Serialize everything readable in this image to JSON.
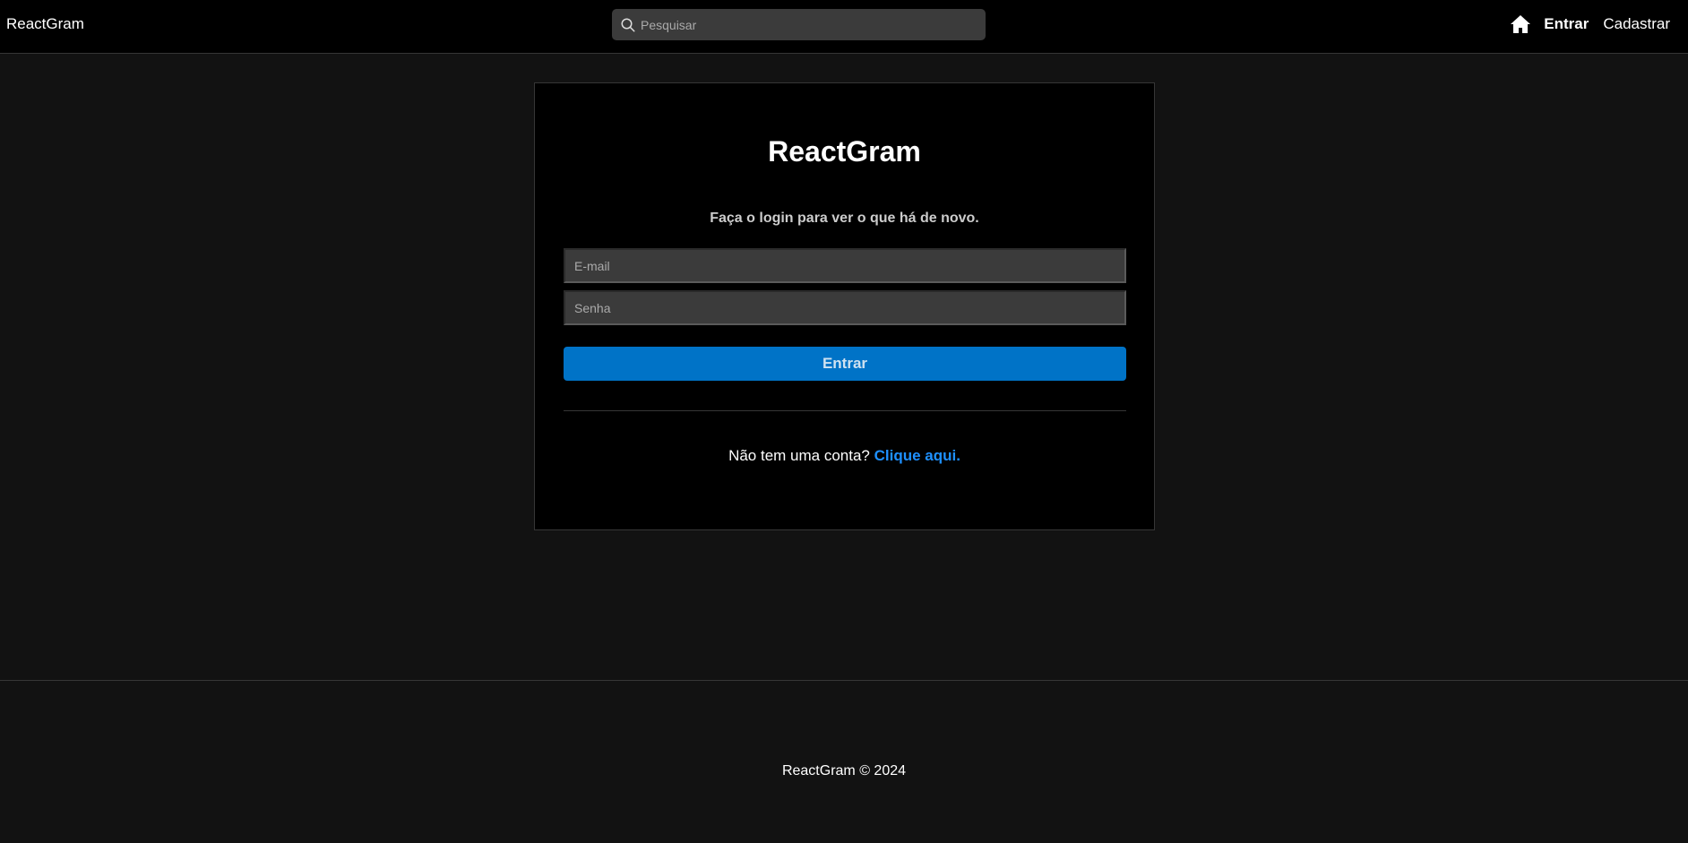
{
  "navbar": {
    "brand": "ReactGram",
    "search": {
      "placeholder": "Pesquisar"
    },
    "links": {
      "login": "Entrar",
      "register": "Cadastrar"
    },
    "icons": {
      "search": "search-icon",
      "home": "home-icon"
    }
  },
  "login_card": {
    "title": "ReactGram",
    "subtitle": "Faça o login para ver o que há de novo.",
    "email_placeholder": "E-mail",
    "password_placeholder": "Senha",
    "submit_label": "Entrar",
    "signup_prompt": "Não tem uma conta? ",
    "signup_link": "Clique aqui."
  },
  "footer": {
    "text": "ReactGram © 2024"
  },
  "colors": {
    "background": "#121212",
    "navbar": "#000000",
    "accent_button": "#0073c7",
    "link": "#1e90ff"
  }
}
